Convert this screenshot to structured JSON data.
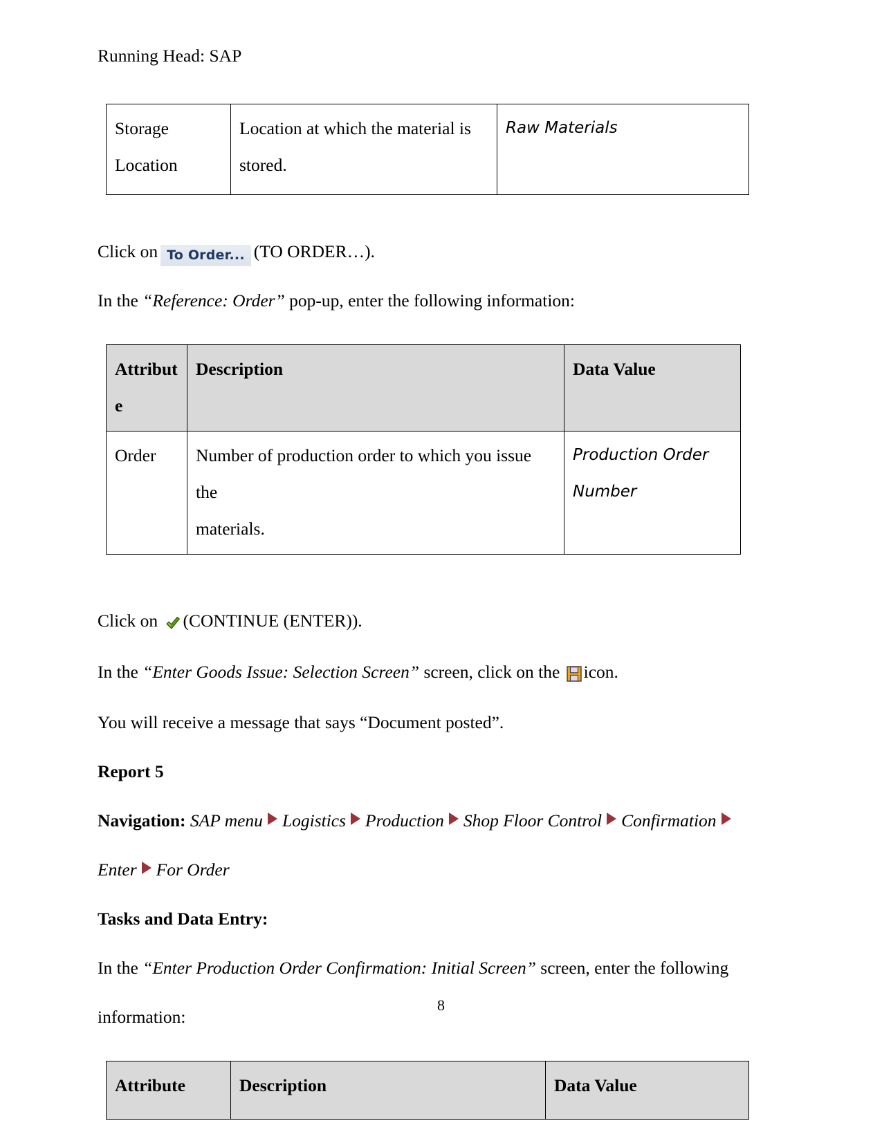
{
  "document": {
    "running_head": "Running Head: SAP",
    "page_number": "8"
  },
  "table_storage_location": {
    "name": "storage-location-table",
    "rows": [
      {
        "attribute_line1": "Storage",
        "attribute_line2": "Location",
        "description_line1": "Location at which the material is",
        "description_line2": "stored.",
        "data_value": "Raw Materials"
      }
    ]
  },
  "click_to_order": {
    "prefix": "Click on",
    "button_label": "To Order...",
    "suffix": "(TO ORDER…)."
  },
  "reference_order_intro": {
    "lead": "In the",
    "quoted": "“Reference: Order”",
    "tail": "pop-up, enter the following information:"
  },
  "table_reference_order": {
    "name": "reference-order-table",
    "headers": {
      "attribute_line1": "Attribut",
      "attribute_line2": "e",
      "description": "Description",
      "data_value": "Data Value"
    },
    "rows": [
      {
        "attribute": "Order",
        "description_line1": "Number of production order to which you issue the",
        "description_line2": "materials.",
        "data_value_line1": "Production Order",
        "data_value_line2": "Number"
      }
    ]
  },
  "click_continue": {
    "prefix": "Click on",
    "icon": "green-check-icon",
    "suffix": "(CONTINUE (ENTER))."
  },
  "goods_issue_line": {
    "lead": "In the",
    "quoted": "“Enter Goods Issue: Selection Screen”",
    "middle": "screen, click on the",
    "icon": "save-floppy-icon",
    "tail": "icon."
  },
  "document_posted_line": "You will receive a message that says “Document posted”.",
  "report_heading": "Report 5",
  "navigation": {
    "label": "Navigation:",
    "arrow_color": "#9B3239",
    "steps": [
      "SAP menu",
      "Logistics",
      "Production",
      "Shop Floor Control",
      "Confirmation",
      "Enter",
      "For Order"
    ]
  },
  "tasks_heading": "Tasks and Data Entry:",
  "confirmation_intro": {
    "lead": "In the",
    "quoted": "“Enter Production Order Confirmation: Initial Screen”",
    "tail": "screen, enter the following",
    "tail2": "information:"
  },
  "table_confirmation": {
    "name": "confirmation-table",
    "headers": {
      "attribute": "Attribute",
      "description": "Description",
      "data_value": "Data Value"
    }
  }
}
